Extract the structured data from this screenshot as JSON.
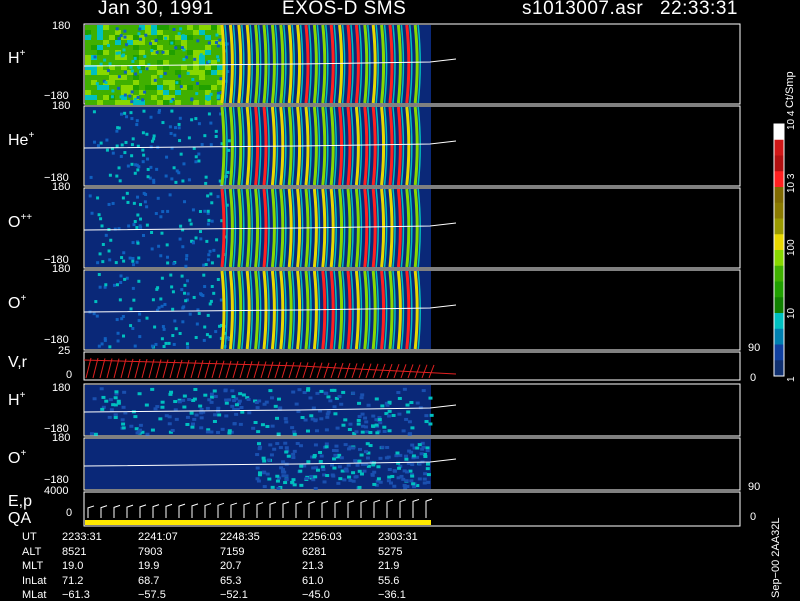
{
  "header": {
    "left": "Jan 30, 1991",
    "center": "EXOS-D SMS",
    "file": "s1013007.asr",
    "time": "22:33:31"
  },
  "panels": [
    {
      "id": "h",
      "label": "H",
      "sup": "+",
      "ymax": "180",
      "ymin": "−180"
    },
    {
      "id": "he",
      "label": "He",
      "sup": "+",
      "ymax": "180",
      "ymin": "−180"
    },
    {
      "id": "opp",
      "label": "O",
      "sup": "++",
      "ymax": "180",
      "ymin": "−180"
    },
    {
      "id": "op",
      "label": "O",
      "sup": "+",
      "ymax": "",
      "ymin": "−180"
    },
    {
      "id": "vr",
      "label": "V,r",
      "sup": "",
      "ymax": "25",
      "ymin": "0",
      "rmax": "90",
      "rmin": "0"
    },
    {
      "id": "h2",
      "label": "H",
      "sup": "+",
      "ymax": "180",
      "ymin": "−180"
    },
    {
      "id": "o2",
      "label": "O",
      "sup": "+",
      "ymax": "180",
      "ymin": "−180"
    },
    {
      "id": "ep",
      "label": "E,p",
      "label2": "QA",
      "sup": "",
      "ymax": "4000",
      "ymin": "0",
      "rmax": "90",
      "rmin": "0"
    }
  ],
  "colorbar": {
    "unit": "Ct/Smp",
    "labels": [
      {
        "text": "10",
        "sup": "4",
        "pos": 0.0
      },
      {
        "text": "10",
        "sup": "3",
        "pos": 0.25
      },
      {
        "text": "100",
        "sup": "",
        "pos": 0.5
      },
      {
        "text": "10",
        "sup": "",
        "pos": 0.75
      },
      {
        "text": "1",
        "sup": "",
        "pos": 1.0
      }
    ],
    "colors": [
      "#ffffff",
      "#d01818",
      "#b01010",
      "#ff2020",
      "#806a00",
      "#8a7a00",
      "#9a9a00",
      "#e8d800",
      "#88d800",
      "#40b000",
      "#20a000",
      "#108000",
      "#00c0c0",
      "#0080b0",
      "#1040a0",
      "#103070"
    ]
  },
  "chart_data": {
    "type": "heatmap",
    "title": "Jan 30, 1991 EXOS-D SMS",
    "ylabel_panels": [
      "H+",
      "He+",
      "O++",
      "O+",
      "V,r",
      "H+",
      "O+",
      "E,p QA"
    ],
    "x_ticks": [
      "2233:31",
      "2241:07",
      "2248:35",
      "2256:03",
      "2303:31"
    ],
    "table": {
      "rows": [
        {
          "name": "UT",
          "values": [
            "2233:31",
            "2241:07",
            "2248:35",
            "2256:03",
            "2303:31"
          ]
        },
        {
          "name": "ALT",
          "values": [
            "8521",
            "7903",
            "7159",
            "6281",
            "5275"
          ]
        },
        {
          "name": "MLT",
          "values": [
            "19.0",
            "19.9",
            "20.7",
            "21.3",
            "21.9"
          ]
        },
        {
          "name": "InLat",
          "values": [
            "71.2",
            "68.7",
            "65.3",
            "61.0",
            "55.6"
          ]
        },
        {
          "name": "MLat",
          "values": [
            "−61.3",
            "−57.5",
            "−52.1",
            "−45.0",
            "−36.1"
          ]
        }
      ]
    }
  },
  "footer": {
    "side": "Sep−00 2AA32L"
  }
}
